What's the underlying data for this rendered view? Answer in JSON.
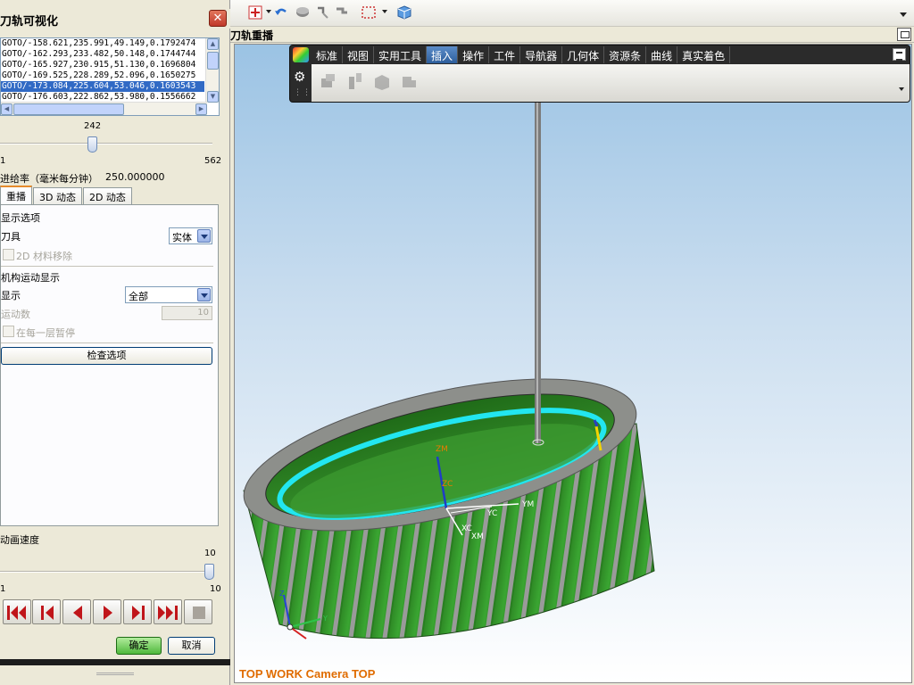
{
  "dialog": {
    "title": "刀轨可视化",
    "close_label": "✕",
    "code_lines": [
      "GOTO/-158.621,235.991,49.149,0.1792474",
      "GOTO/-162.293,233.482,50.148,0.1744744",
      "GOTO/-165.927,230.915,51.130,0.1696804",
      "GOTO/-169.525,228.289,52.096,0.1650275",
      "GOTO/-173.084,225.604,53.046,0.1603543",
      "GOTO/-176.603,222.862,53.980,0.1556662"
    ],
    "selected_line_index": 4,
    "slider": {
      "current": "242",
      "min": "1",
      "max": "562",
      "current_value": 242,
      "min_value": 1,
      "max_value": 562
    },
    "feed_rate_label": "进给率（毫米每分钟）",
    "feed_rate_value": "250.000000",
    "tabs": [
      "重播",
      "3D 动态",
      "2D 动态"
    ],
    "active_tab": "重播",
    "display_options_heading": "显示选项",
    "tool_label": "刀具",
    "tool_value": "实体",
    "material_removal_label": "2D 材料移除",
    "mechanism_heading": "机构运动显示",
    "display_label": "显示",
    "display_value": "全部",
    "motion_count_label": "运动数",
    "motion_count_value": "10",
    "pause_each_layer_label": "在每一层暂停",
    "check_options_label": "检查选项",
    "anim_speed_label": "动画速度",
    "speed": {
      "current": "10",
      "min": "1",
      "max": "10",
      "current_value": 10,
      "max_value": 10
    },
    "ok_label": "确定",
    "cancel_label": "取消"
  },
  "subbar": {
    "title": "刀轨重播"
  },
  "ribbon": {
    "tabs": [
      "标准",
      "视图",
      "实用工具",
      "插入",
      "操作",
      "工件",
      "导航器",
      "几何体",
      "资源条",
      "曲线",
      "真实着色"
    ],
    "active_tab": "插入"
  },
  "viewport": {
    "label": "TOP WORK Camera TOP",
    "axis_labels": {
      "zm": "ZM",
      "zc": "ZC",
      "yc": "YC",
      "ym": "YM",
      "xc": "XC",
      "xm": "XM",
      "z": "Z",
      "y": "Y"
    }
  },
  "colors": {
    "part_green": "#3c9a30",
    "stripe_gray": "#9a9a9a",
    "cyan": "#22e6f0",
    "label_orange": "#e06c00",
    "selection": "#316ac5"
  }
}
